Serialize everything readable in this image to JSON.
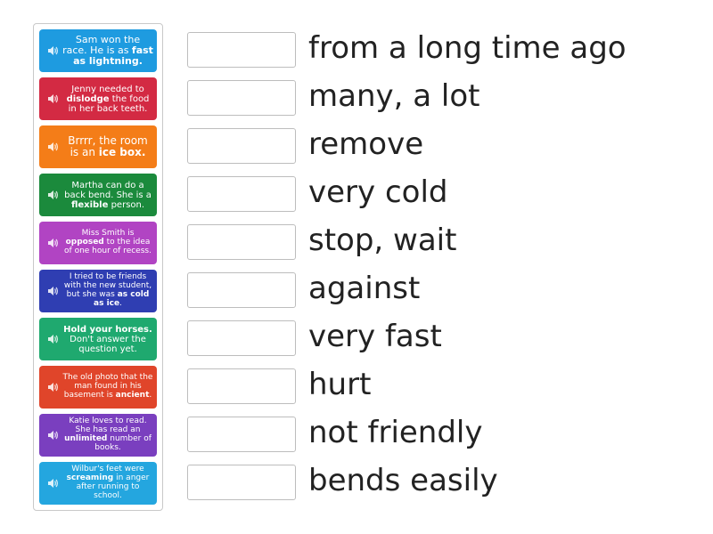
{
  "colors": {
    "blue": "#1e9be0",
    "red": "#d32a43",
    "orange": "#f47d18",
    "green": "#1b8a3c",
    "magenta": "#b144c3",
    "indigo": "#2f3eb2",
    "teal": "#1fa96f",
    "redorange": "#e0452a",
    "purple": "#7a3fbf",
    "sky": "#24a6df"
  },
  "cards": [
    {
      "color": "blue",
      "parts": [
        {
          "t": "Sam won the race. He is as "
        },
        {
          "t": "fast as lightning.",
          "b": true
        }
      ]
    },
    {
      "color": "red",
      "parts": [
        {
          "t": "Jenny needed to "
        },
        {
          "t": "dislodge",
          "b": true
        },
        {
          "t": " the food in her back teeth."
        }
      ]
    },
    {
      "color": "orange",
      "parts": [
        {
          "t": "Brrrr, the room is an "
        },
        {
          "t": "ice box.",
          "b": true
        }
      ]
    },
    {
      "color": "green",
      "parts": [
        {
          "t": "Martha can do a back bend. She is a "
        },
        {
          "t": "flexible",
          "b": true
        },
        {
          "t": " person."
        }
      ]
    },
    {
      "color": "magenta",
      "parts": [
        {
          "t": "Miss Smith is "
        },
        {
          "t": "opposed",
          "b": true
        },
        {
          "t": " to the idea of one hour of recess."
        }
      ]
    },
    {
      "color": "indigo",
      "parts": [
        {
          "t": "I tried to be friends with the new student, but she was "
        },
        {
          "t": "as cold as ice",
          "b": true
        },
        {
          "t": "."
        }
      ]
    },
    {
      "color": "teal",
      "parts": [
        {
          "t": "Hold your horses.",
          "b": true
        },
        {
          "t": " Don't answer the question yet."
        }
      ]
    },
    {
      "color": "redorange",
      "parts": [
        {
          "t": "The old photo that the man found in his basement is "
        },
        {
          "t": "ancient",
          "b": true
        },
        {
          "t": "."
        }
      ]
    },
    {
      "color": "purple",
      "parts": [
        {
          "t": "Katie loves to read. She has read an "
        },
        {
          "t": "unlimited",
          "b": true
        },
        {
          "t": " number of books."
        }
      ]
    },
    {
      "color": "sky",
      "parts": [
        {
          "t": "Wilbur's feet were "
        },
        {
          "t": "screaming",
          "b": true
        },
        {
          "t": " in anger after running to school."
        }
      ]
    }
  ],
  "definitions": [
    "from a long time ago",
    "many, a lot",
    "remove",
    "very cold",
    "stop, wait",
    "against",
    "very fast",
    "hurt",
    "not friendly",
    "bends easily"
  ],
  "speaker_icon": "speaker-icon"
}
